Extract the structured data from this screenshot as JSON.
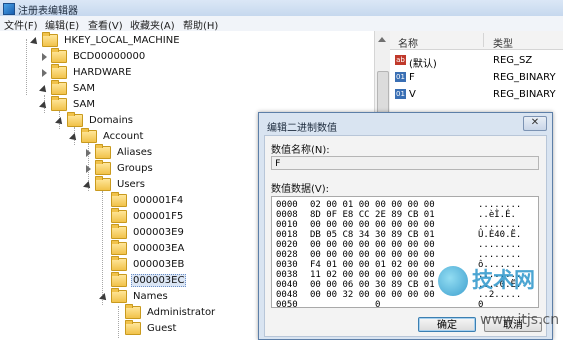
{
  "window": {
    "title": "注册表编辑器"
  },
  "menu": [
    "文件(F)",
    "编辑(E)",
    "查看(V)",
    "收藏夹(A)",
    "帮助(H)"
  ],
  "tree": {
    "items": [
      {
        "label": "HKEY_LOCAL_MACHINE",
        "level": 1,
        "exp": "open"
      },
      {
        "label": "BCD00000000",
        "level": 2,
        "exp": "closed"
      },
      {
        "label": "HARDWARE",
        "level": 2,
        "exp": "closed"
      },
      {
        "label": "SAM",
        "level": 2,
        "exp": "open"
      },
      {
        "label": "SAM",
        "level": 3,
        "exp": "open"
      },
      {
        "label": "Domains",
        "level": 4,
        "exp": "open"
      },
      {
        "label": "Account",
        "level": 5,
        "exp": "open"
      },
      {
        "label": "Aliases",
        "level": 6,
        "exp": "closed"
      },
      {
        "label": "Groups",
        "level": 6,
        "exp": "closed"
      },
      {
        "label": "Users",
        "level": 6,
        "exp": "open"
      },
      {
        "label": "000001F4",
        "level": 7,
        "exp": "none"
      },
      {
        "label": "000001F5",
        "level": 7,
        "exp": "none"
      },
      {
        "label": "000003E9",
        "level": 7,
        "exp": "none"
      },
      {
        "label": "000003EA",
        "level": 7,
        "exp": "none"
      },
      {
        "label": "000003EB",
        "level": 7,
        "exp": "none"
      },
      {
        "label": "000003EC",
        "level": 7,
        "exp": "none",
        "selected": true
      },
      {
        "label": "Names",
        "level": 7,
        "exp": "open"
      },
      {
        "label": "Administrator",
        "level": 8,
        "exp": "none"
      },
      {
        "label": "Guest",
        "level": 8,
        "exp": "none"
      }
    ]
  },
  "values_pane": {
    "col_name": "名称",
    "col_type": "类型",
    "rows": [
      {
        "icon": "string-value-icon",
        "badge": "ab",
        "name": "(默认)",
        "type": "REG_SZ"
      },
      {
        "icon": "binary-value-icon",
        "badge": "01",
        "name": "F",
        "type": "REG_BINARY"
      },
      {
        "icon": "binary-value-icon",
        "badge": "01",
        "name": "V",
        "type": "REG_BINARY"
      }
    ]
  },
  "dialog": {
    "title": "编辑二进制数值",
    "close": "✕",
    "value_name_label": "数值名称(N):",
    "value_name": "F",
    "value_data_label": "数值数据(V):",
    "hex_rows": [
      {
        "addr": "0000",
        "bytes": "02 00 01 00 00 00 00 00",
        "ascii": "........"
      },
      {
        "addr": "0008",
        "bytes": "8D 0F E8 CC 2E 89 CB 01",
        "ascii": "..èÌ.É."
      },
      {
        "addr": "0010",
        "bytes": "00 00 00 00 00 00 00 00",
        "ascii": "........"
      },
      {
        "addr": "0018",
        "bytes": "DB 05 C8 34 30 89 CB 01",
        "ascii": "Û.È40.Ë."
      },
      {
        "addr": "0020",
        "bytes": "00 00 00 00 00 00 00 00",
        "ascii": "........"
      },
      {
        "addr": "0028",
        "bytes": "00 00 00 00 00 00 00 00",
        "ascii": "........"
      },
      {
        "addr": "0030",
        "bytes": "F4 01 00 00 01 02 00 00",
        "ascii": "ô......."
      },
      {
        "addr": "0038",
        "bytes": "11 02 00 00 00 00 00 00",
        "ascii": "........"
      },
      {
        "addr": "0040",
        "bytes": "00 00 06 00 30 89 CB 01",
        "ascii": "....0.Ë."
      },
      {
        "addr": "0048",
        "bytes": "00 00 32 00 00 00 00 00",
        "ascii": "..2....."
      },
      {
        "addr": "0050",
        "bytes": "            0           ",
        "ascii": "0"
      }
    ],
    "ok": "确定",
    "cancel": "取消"
  },
  "watermark": {
    "text": "技术网",
    "url": "www.itjs.cn"
  }
}
